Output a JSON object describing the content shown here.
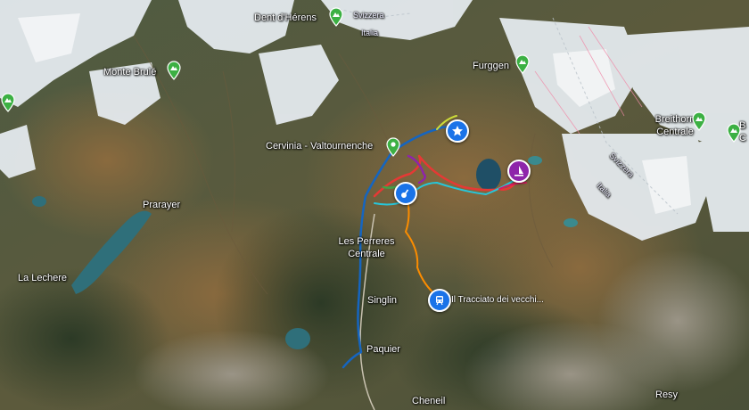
{
  "labels": {
    "dent_dherens": "Dent d'Hérens",
    "svizzera_top": "Svizzera",
    "italia_top": "Italia",
    "furggen": "Furggen",
    "monte_brule": "Monte Brulé",
    "cervinia": "Cervinia - Valtournenche",
    "breithorn": "Breithorn Centrale",
    "b_edge": "B",
    "c_edge": "C",
    "svizzera_right": "Svizzera",
    "italia_right": "Italia",
    "prarayer": "Prarayer",
    "la_lechere": "La Lechere",
    "les_perreres": "Les Perreres Centrale",
    "singlin": "Singlin",
    "paquier": "Paquier",
    "cheneil": "Cheneil",
    "resy": "Resy",
    "tracciato": "Il Tracciato dei vecchi..."
  },
  "colors": {
    "peak_pin": "#3cb043",
    "poi": "#1a73e8",
    "trail_blue": "#1565c0",
    "trail_red": "#e53935",
    "trail_orange": "#fb8c00",
    "trail_purple": "#8e24aa",
    "trail_teal": "#26c6da",
    "trail_green": "#43a047",
    "trail_yellow": "#cddc39",
    "trail_magenta": "#d81b60",
    "lake": "#2f6f7a"
  },
  "icons": {
    "peak": "mountain-pin-icon",
    "town": "location-pin-icon",
    "star_poi": "star-icon",
    "guitar_poi": "guitar-icon",
    "windsurf_poi": "windsurf-icon",
    "train_poi": "train-icon"
  }
}
